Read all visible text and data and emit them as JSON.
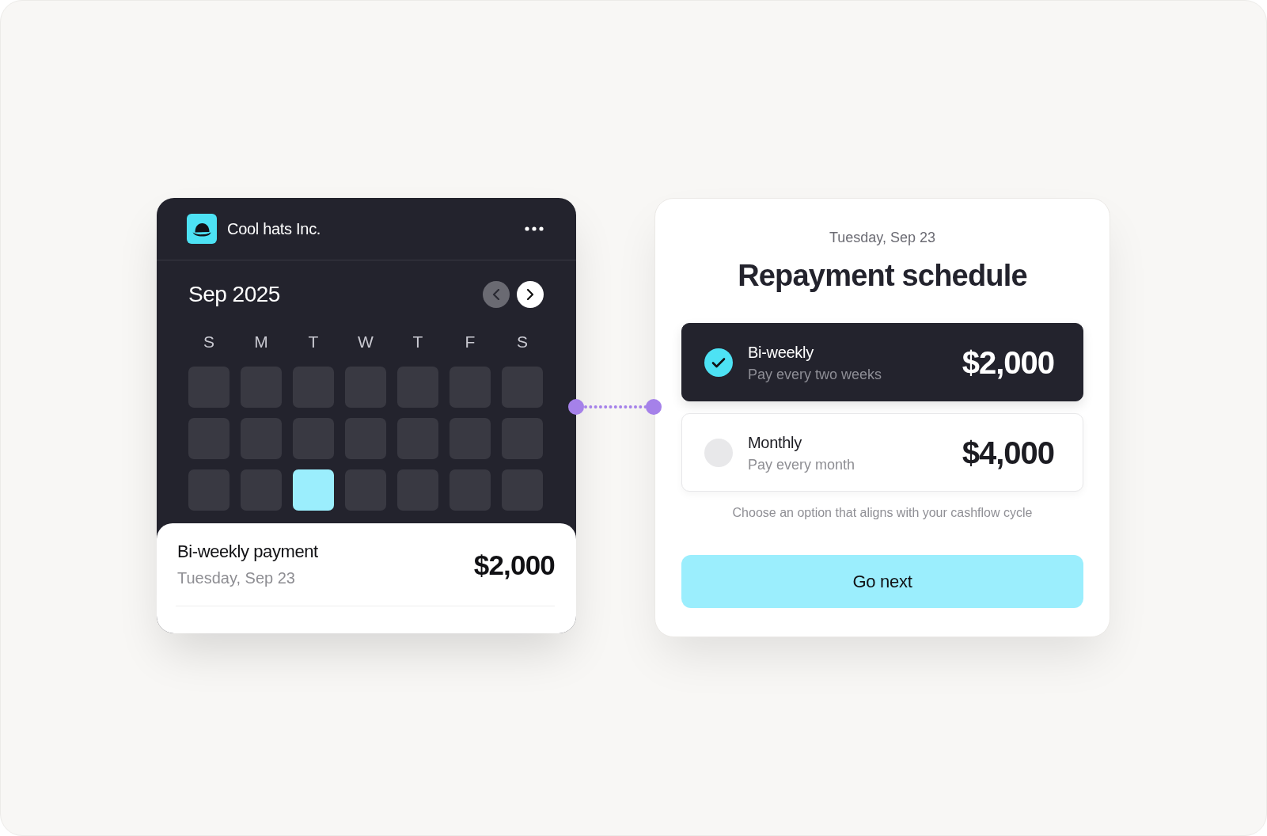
{
  "calendar_card": {
    "company_name": "Cool hats Inc.",
    "month": "Sep 2025",
    "nav_buttons": [
      {
        "kind": "prev",
        "disabled": true
      },
      {
        "kind": "next",
        "disabled": false
      }
    ],
    "weekdays": [
      "S",
      "M",
      "T",
      "W",
      "T",
      "F",
      "S"
    ],
    "days": [
      {
        "selected": false
      },
      {
        "selected": false
      },
      {
        "selected": false
      },
      {
        "selected": false
      },
      {
        "selected": false
      },
      {
        "selected": false
      },
      {
        "selected": false
      },
      {
        "selected": false
      },
      {
        "selected": false
      },
      {
        "selected": false
      },
      {
        "selected": false
      },
      {
        "selected": false
      },
      {
        "selected": false
      },
      {
        "selected": false
      },
      {
        "selected": false
      },
      {
        "selected": false
      },
      {
        "selected": true
      },
      {
        "selected": false
      },
      {
        "selected": false
      },
      {
        "selected": false
      },
      {
        "selected": false
      }
    ],
    "payment": {
      "title": "Bi-weekly payment",
      "date": "Tuesday, Sep 23",
      "amount": "$2,000"
    }
  },
  "schedule_card": {
    "date": "Tuesday, Sep 23",
    "title": "Repayment schedule",
    "options": [
      {
        "label": "Bi-weekly",
        "description": "Pay every two weeks",
        "amount": "$2,000",
        "selected": true
      },
      {
        "label": "Monthly",
        "description": "Pay every month",
        "amount": "$4,000",
        "selected": false
      }
    ],
    "hint": "Choose an option that aligns with your cashflow cycle",
    "button": "Go next"
  }
}
